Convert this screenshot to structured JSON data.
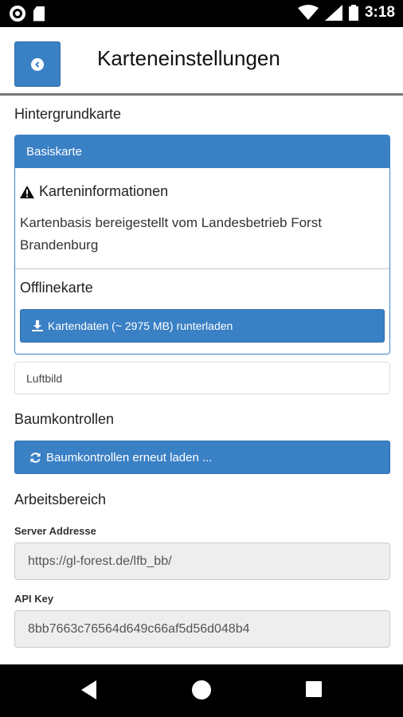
{
  "status_bar": {
    "time": "3:18"
  },
  "header": {
    "title": "Karteneinstellungen",
    "back_icon": "chevron-left-circle-icon"
  },
  "sections": {
    "background_map": "Hintergrundkarte",
    "tree_controls": "Baumkontrollen",
    "workspace": "Arbeitsbereich"
  },
  "basemap_panel": {
    "heading": "Basiskarte",
    "info_title": "Karteninformationen",
    "info_text": "Kartenbasis bereigestellt vom Landesbetrieb Forst Brandenburg",
    "offline_title": "Offlinekarte",
    "download_label": "Kartendaten (~ 2975 MB) runterladen"
  },
  "aerial_option": "Luftbild",
  "reload_label": "Baumkontrollen erneut laden ...",
  "fields": {
    "server_label": "Server Addresse",
    "server_value": "https://gl-forest.de/lfb_bb/",
    "api_label": "API Key",
    "api_value": "8bb7663c76564d649c66af5d56d048b4"
  },
  "colors": {
    "primary": "#3a80c5",
    "input_bg": "#eeeeee"
  }
}
